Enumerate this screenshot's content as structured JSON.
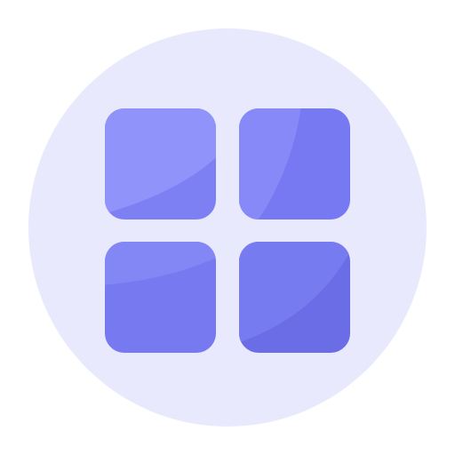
{
  "icon": {
    "name": "app-grid-icon",
    "colors": {
      "background_circle": "#e9e9fd",
      "tile_top_left": "#8a8ef8",
      "tile_top_right": "#8588f6",
      "tile_bottom_left": "#787cf1",
      "tile_bottom_right": "#6c6ee8",
      "highlight": "#ffffff"
    }
  }
}
